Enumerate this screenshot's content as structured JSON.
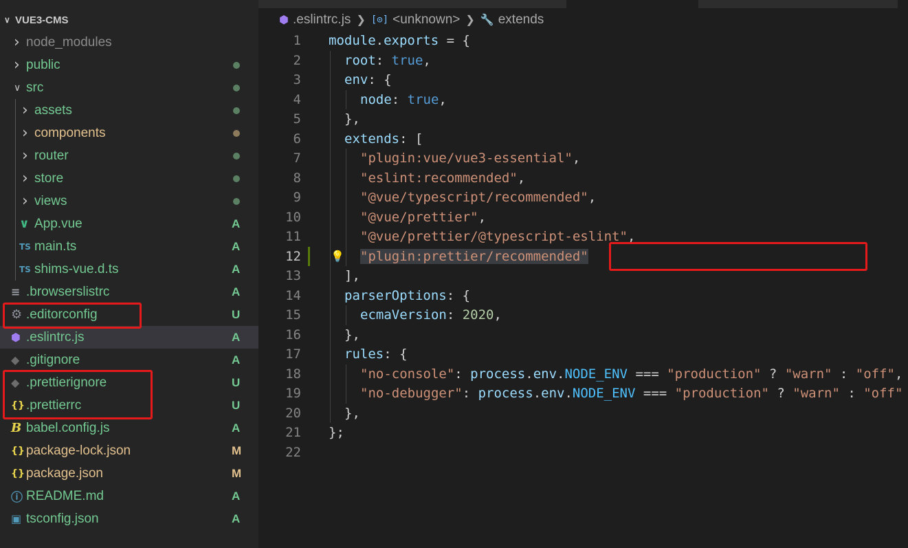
{
  "explorer": {
    "root_title": "VUE3-CMS",
    "items": [
      {
        "label": "node_modules",
        "kind": "folder",
        "expanded": false,
        "depth": 0,
        "status": "",
        "color": "#8b8b8b",
        "status_color": ""
      },
      {
        "label": "public",
        "kind": "folder",
        "expanded": false,
        "depth": 0,
        "status": "dot",
        "color": "#73c991",
        "status_color": "#5b7f63"
      },
      {
        "label": "src",
        "kind": "folder",
        "expanded": true,
        "depth": 0,
        "status": "dot",
        "color": "#73c991",
        "status_color": "#5b7f63"
      },
      {
        "label": "assets",
        "kind": "folder",
        "expanded": false,
        "depth": 1,
        "status": "dot",
        "color": "#73c991",
        "status_color": "#5b7f63"
      },
      {
        "label": "components",
        "kind": "folder",
        "expanded": false,
        "depth": 1,
        "status": "dot",
        "color": "#e2c08d",
        "status_color": "#8c7a5b"
      },
      {
        "label": "router",
        "kind": "folder",
        "expanded": false,
        "depth": 1,
        "status": "dot",
        "color": "#73c991",
        "status_color": "#5b7f63"
      },
      {
        "label": "store",
        "kind": "folder",
        "expanded": false,
        "depth": 1,
        "status": "dot",
        "color": "#73c991",
        "status_color": "#5b7f63"
      },
      {
        "label": "views",
        "kind": "folder",
        "expanded": false,
        "depth": 1,
        "status": "dot",
        "color": "#73c991",
        "status_color": "#5b7f63"
      },
      {
        "label": "App.vue",
        "kind": "file",
        "icon": "vue-icon",
        "depth": 1,
        "status": "A",
        "color": "#73c991",
        "status_color": "#73c991"
      },
      {
        "label": "main.ts",
        "kind": "file",
        "icon": "ts-icon",
        "depth": 1,
        "status": "A",
        "color": "#73c991",
        "status_color": "#73c991"
      },
      {
        "label": "shims-vue.d.ts",
        "kind": "file",
        "icon": "ts-icon",
        "depth": 1,
        "status": "A",
        "color": "#73c991",
        "status_color": "#73c991"
      },
      {
        "label": ".browserslistrc",
        "kind": "file",
        "icon": "list-icon",
        "depth": 0,
        "status": "A",
        "color": "#73c991",
        "status_color": "#73c991"
      },
      {
        "label": ".editorconfig",
        "kind": "file",
        "icon": "gear-icon",
        "depth": 0,
        "status": "U",
        "color": "#73c991",
        "status_color": "#73c991",
        "highlight": true
      },
      {
        "label": ".eslintrc.js",
        "kind": "file",
        "icon": "eslint-icon",
        "depth": 0,
        "status": "A",
        "color": "#73c991",
        "status_color": "#73c991",
        "active": true
      },
      {
        "label": ".gitignore",
        "kind": "file",
        "icon": "git-icon",
        "depth": 0,
        "status": "A",
        "color": "#73c991",
        "status_color": "#73c991"
      },
      {
        "label": ".prettierignore",
        "kind": "file",
        "icon": "git-icon",
        "depth": 0,
        "status": "U",
        "color": "#73c991",
        "status_color": "#73c991",
        "highlight": true
      },
      {
        "label": ".prettierrc",
        "kind": "file",
        "icon": "json-icon",
        "depth": 0,
        "status": "U",
        "color": "#73c991",
        "status_color": "#73c991",
        "highlight": true
      },
      {
        "label": "babel.config.js",
        "kind": "file",
        "icon": "babel-icon",
        "depth": 0,
        "status": "A",
        "color": "#73c991",
        "status_color": "#73c991"
      },
      {
        "label": "package-lock.json",
        "kind": "file",
        "icon": "json-icon",
        "depth": 0,
        "status": "M",
        "color": "#e2c08d",
        "status_color": "#e2c08d"
      },
      {
        "label": "package.json",
        "kind": "file",
        "icon": "json-icon",
        "depth": 0,
        "status": "M",
        "color": "#e2c08d",
        "status_color": "#e2c08d"
      },
      {
        "label": "README.md",
        "kind": "file",
        "icon": "info-icon",
        "depth": 0,
        "status": "A",
        "color": "#73c991",
        "status_color": "#73c991"
      },
      {
        "label": "tsconfig.json",
        "kind": "file",
        "icon": "tsconfig-icon",
        "depth": 0,
        "status": "A",
        "color": "#73c991",
        "status_color": "#73c991"
      }
    ]
  },
  "breadcrumb": {
    "file": ".eslintrc.js",
    "scope": "<unknown>",
    "symbol": "extends"
  },
  "editor": {
    "current_line": 12,
    "modified_line": 12,
    "lines": [
      {
        "n": "1",
        "guides": 0,
        "tokens": [
          [
            "module",
            "k"
          ],
          [
            ".",
            "p"
          ],
          [
            "exports",
            "k"
          ],
          [
            " = {",
            "p"
          ]
        ]
      },
      {
        "n": "2",
        "guides": 1,
        "tokens": [
          [
            "root",
            "k"
          ],
          [
            ": ",
            "p"
          ],
          [
            "true",
            "b"
          ],
          [
            ",",
            "p"
          ]
        ]
      },
      {
        "n": "3",
        "guides": 1,
        "tokens": [
          [
            "env",
            "k"
          ],
          [
            ": {",
            "p"
          ]
        ]
      },
      {
        "n": "4",
        "guides": 2,
        "tokens": [
          [
            "node",
            "k"
          ],
          [
            ": ",
            "p"
          ],
          [
            "true",
            "b"
          ],
          [
            ",",
            "p"
          ]
        ]
      },
      {
        "n": "5",
        "guides": 1,
        "tokens": [
          [
            "},",
            "p"
          ]
        ]
      },
      {
        "n": "6",
        "guides": 1,
        "tokens": [
          [
            "extends",
            "k"
          ],
          [
            ": [",
            "p"
          ]
        ]
      },
      {
        "n": "7",
        "guides": 2,
        "tokens": [
          [
            "\"plugin:vue/vue3-essential\"",
            "s"
          ],
          [
            ",",
            "p"
          ]
        ]
      },
      {
        "n": "8",
        "guides": 2,
        "tokens": [
          [
            "\"eslint:recommended\"",
            "s"
          ],
          [
            ",",
            "p"
          ]
        ]
      },
      {
        "n": "9",
        "guides": 2,
        "tokens": [
          [
            "\"@vue/typescript/recommended\"",
            "s"
          ],
          [
            ",",
            "p"
          ]
        ]
      },
      {
        "n": "10",
        "guides": 2,
        "tokens": [
          [
            "\"@vue/prettier\"",
            "s"
          ],
          [
            ",",
            "p"
          ]
        ]
      },
      {
        "n": "11",
        "guides": 2,
        "tokens": [
          [
            "\"@vue/prettier/@typescript-eslint\"",
            "s"
          ],
          [
            ",",
            "p"
          ]
        ]
      },
      {
        "n": "12",
        "guides": 2,
        "tokens": [
          [
            "\"plugin:prettier/recommended\"",
            "s sel"
          ]
        ],
        "bulb": true
      },
      {
        "n": "13",
        "guides": 1,
        "tokens": [
          [
            "],",
            "p"
          ]
        ]
      },
      {
        "n": "14",
        "guides": 1,
        "tokens": [
          [
            "parserOptions",
            "k"
          ],
          [
            ": {",
            "p"
          ]
        ]
      },
      {
        "n": "15",
        "guides": 2,
        "tokens": [
          [
            "ecmaVersion",
            "k"
          ],
          [
            ": ",
            "p"
          ],
          [
            "2020",
            "n"
          ],
          [
            ",",
            "p"
          ]
        ]
      },
      {
        "n": "16",
        "guides": 1,
        "tokens": [
          [
            "},",
            "p"
          ]
        ]
      },
      {
        "n": "17",
        "guides": 1,
        "tokens": [
          [
            "rules",
            "k"
          ],
          [
            ": {",
            "p"
          ]
        ]
      },
      {
        "n": "18",
        "guides": 2,
        "tokens": [
          [
            "\"no-console\"",
            "s"
          ],
          [
            ": ",
            "p"
          ],
          [
            "process",
            "k"
          ],
          [
            ".",
            "p"
          ],
          [
            "env",
            "k"
          ],
          [
            ".",
            "p"
          ],
          [
            "NODE_ENV",
            "c"
          ],
          [
            " === ",
            "p"
          ],
          [
            "\"production\"",
            "s"
          ],
          [
            " ? ",
            "p"
          ],
          [
            "\"warn\"",
            "s"
          ],
          [
            " : ",
            "p"
          ],
          [
            "\"off\"",
            "s"
          ],
          [
            ",",
            "p"
          ]
        ]
      },
      {
        "n": "19",
        "guides": 2,
        "tokens": [
          [
            "\"no-debugger\"",
            "s"
          ],
          [
            ": ",
            "p"
          ],
          [
            "process",
            "k"
          ],
          [
            ".",
            "p"
          ],
          [
            "env",
            "k"
          ],
          [
            ".",
            "p"
          ],
          [
            "NODE_ENV",
            "c"
          ],
          [
            " === ",
            "p"
          ],
          [
            "\"production\"",
            "s"
          ],
          [
            " ? ",
            "p"
          ],
          [
            "\"warn\"",
            "s"
          ],
          [
            " : ",
            "p"
          ],
          [
            "\"off\"",
            "s"
          ]
        ]
      },
      {
        "n": "20",
        "guides": 1,
        "tokens": [
          [
            "},",
            "p"
          ]
        ]
      },
      {
        "n": "21",
        "guides": 0,
        "tokens": [
          [
            "};",
            "p"
          ]
        ]
      },
      {
        "n": "22",
        "guides": 0,
        "tokens": []
      }
    ]
  },
  "annotation_color": "#e51b1b"
}
